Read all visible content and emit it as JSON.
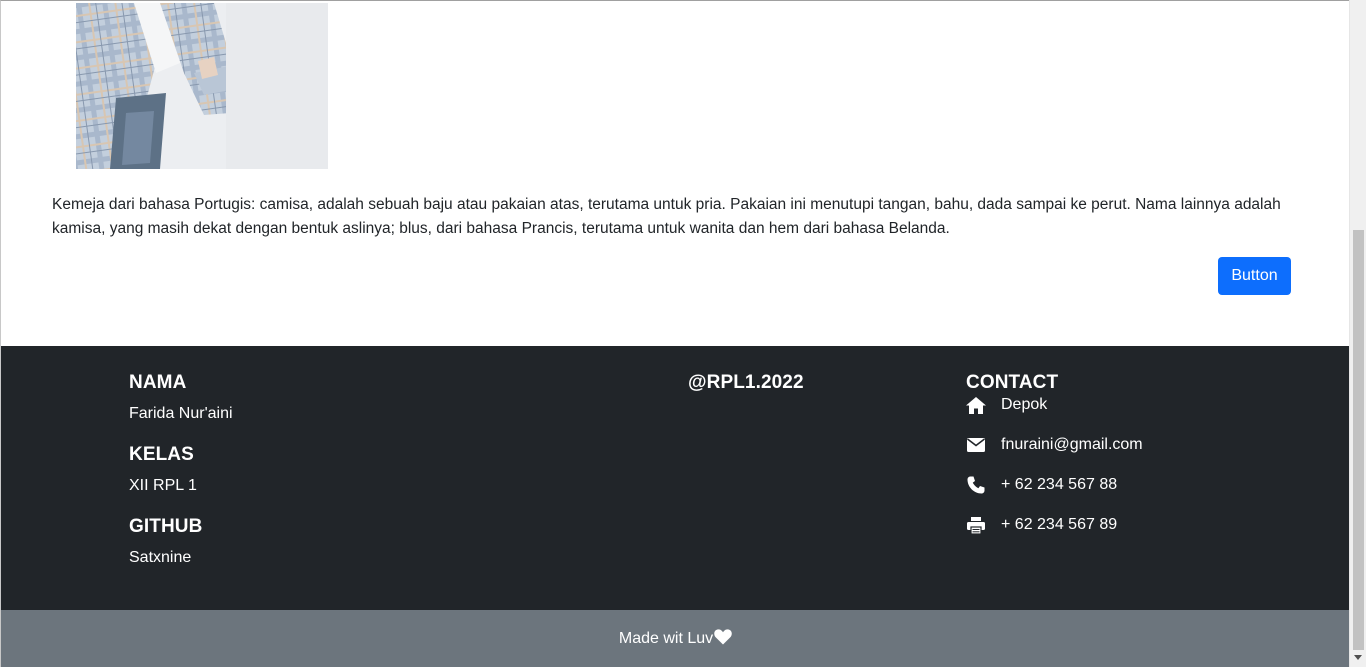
{
  "product": {
    "image_alt": "plaid-shirt-photo",
    "description": "Kemeja dari bahasa Portugis: camisa, adalah sebuah baju atau pakaian atas, terutama untuk pria. Pakaian ini menutupi tangan, bahu, dada sampai ke perut. Nama lainnya adalah kamisa, yang masih dekat dengan bentuk aslinya; blus, dari bahasa Prancis, terutama untuk wanita dan hem dari bahasa Belanda.",
    "button_label": "Button"
  },
  "footer": {
    "nama_heading": "NAMA",
    "nama_value": "Farida Nur'aini",
    "kelas_heading": "KELAS",
    "kelas_value": "XII RPL 1",
    "github_heading": "GITHUB",
    "github_value": "Satxnine",
    "handle": "@RPL1.2022",
    "contact_heading": "CONTACT",
    "contact": {
      "address": "Depok",
      "email": "fnuraini@gmail.com",
      "phone": "+ 62 234 567 88",
      "fax": "+ 62 234 567 89"
    }
  },
  "bottom_bar": {
    "text": "Made wit Luv"
  },
  "icons": {
    "address": "home-icon",
    "email": "envelope-icon",
    "phone": "phone-icon",
    "fax": "printer-icon",
    "heart": "heart-icon"
  },
  "colors": {
    "primary": "#0d6efd",
    "footer_bg": "#212529",
    "bottom_bar_bg": "#6c757d"
  }
}
